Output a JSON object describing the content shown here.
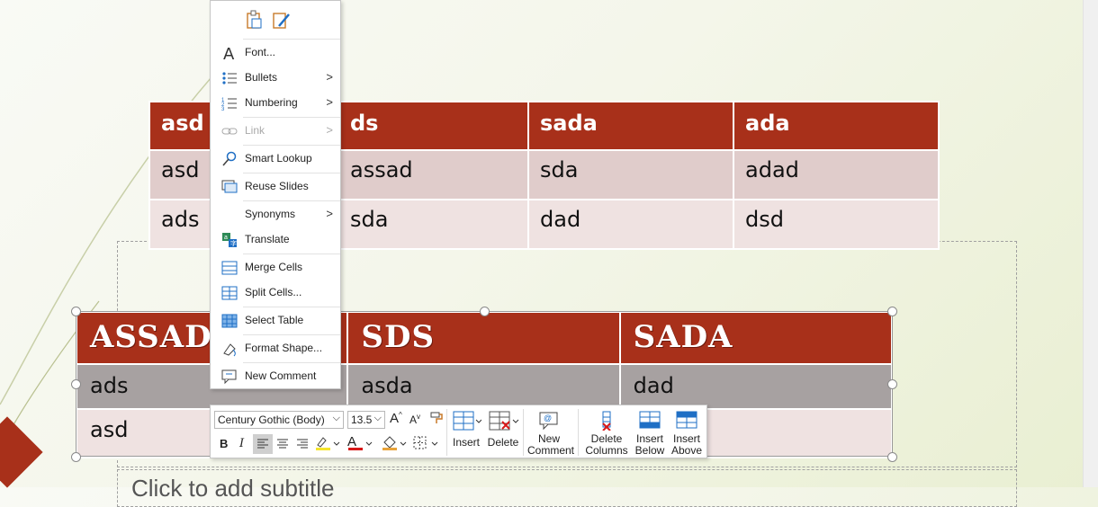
{
  "context_menu": {
    "items": [
      {
        "label": "Font...",
        "icon": "font-icon",
        "submenu": false,
        "disabled": false
      },
      {
        "label": "Bullets",
        "icon": "bullets-icon",
        "submenu": true,
        "disabled": false
      },
      {
        "label": "Numbering",
        "icon": "numbering-icon",
        "submenu": true,
        "disabled": false
      },
      {
        "label": "Link",
        "icon": "link-icon",
        "submenu": true,
        "disabled": true
      },
      {
        "label": "Smart Lookup",
        "icon": "smart-lookup-icon",
        "submenu": false,
        "disabled": false
      },
      {
        "label": "Reuse Slides",
        "icon": "reuse-slides-icon",
        "submenu": false,
        "disabled": false
      },
      {
        "label": "Synonyms",
        "icon": "",
        "submenu": true,
        "disabled": false
      },
      {
        "label": "Translate",
        "icon": "translate-icon",
        "submenu": false,
        "disabled": false
      },
      {
        "label": "Merge Cells",
        "icon": "merge-cells-icon",
        "submenu": false,
        "disabled": false
      },
      {
        "label": "Split Cells...",
        "icon": "split-cells-icon",
        "submenu": false,
        "disabled": false
      },
      {
        "label": "Select Table",
        "icon": "select-table-icon",
        "submenu": false,
        "disabled": false
      },
      {
        "label": "Format Shape...",
        "icon": "format-shape-icon",
        "submenu": false,
        "disabled": false
      },
      {
        "label": "New Comment",
        "icon": "new-comment-icon",
        "submenu": false,
        "disabled": false
      }
    ],
    "paste_options": [
      "paste-icon",
      "paste-special-icon"
    ]
  },
  "table_top": {
    "header": [
      "asd",
      "ds",
      "sada",
      "ada"
    ],
    "rows": [
      [
        "asd",
        "assad",
        "sda",
        "adad"
      ],
      [
        "ads",
        "sda",
        "dad",
        "dsd"
      ]
    ]
  },
  "table_selected": {
    "header": [
      "ASSAD",
      "SDS",
      "SADA"
    ],
    "rows": [
      [
        "ads",
        "asda",
        "dad"
      ],
      [
        "asd",
        "",
        ""
      ]
    ]
  },
  "mini_toolbar": {
    "font_name": "Century Gothic (Body)",
    "font_size": "13.5",
    "grow_font": "A",
    "shrink_font": "A",
    "bold": "B",
    "italic": "I",
    "insert_label": "Insert",
    "delete_label": "Delete",
    "new_comment_label": "New Comment",
    "delete_columns_label": "Delete Columns",
    "insert_below_label": "Insert Below",
    "insert_above_label": "Insert Above",
    "font_color_letter": "A"
  },
  "slide": {
    "subtitle_placeholder": "Click to add subtitle"
  },
  "colors": {
    "header": "#a8301a",
    "row_dark": "#a7a1a1",
    "row_light": "#efe2e1",
    "row_mid": "#e0cccb"
  }
}
